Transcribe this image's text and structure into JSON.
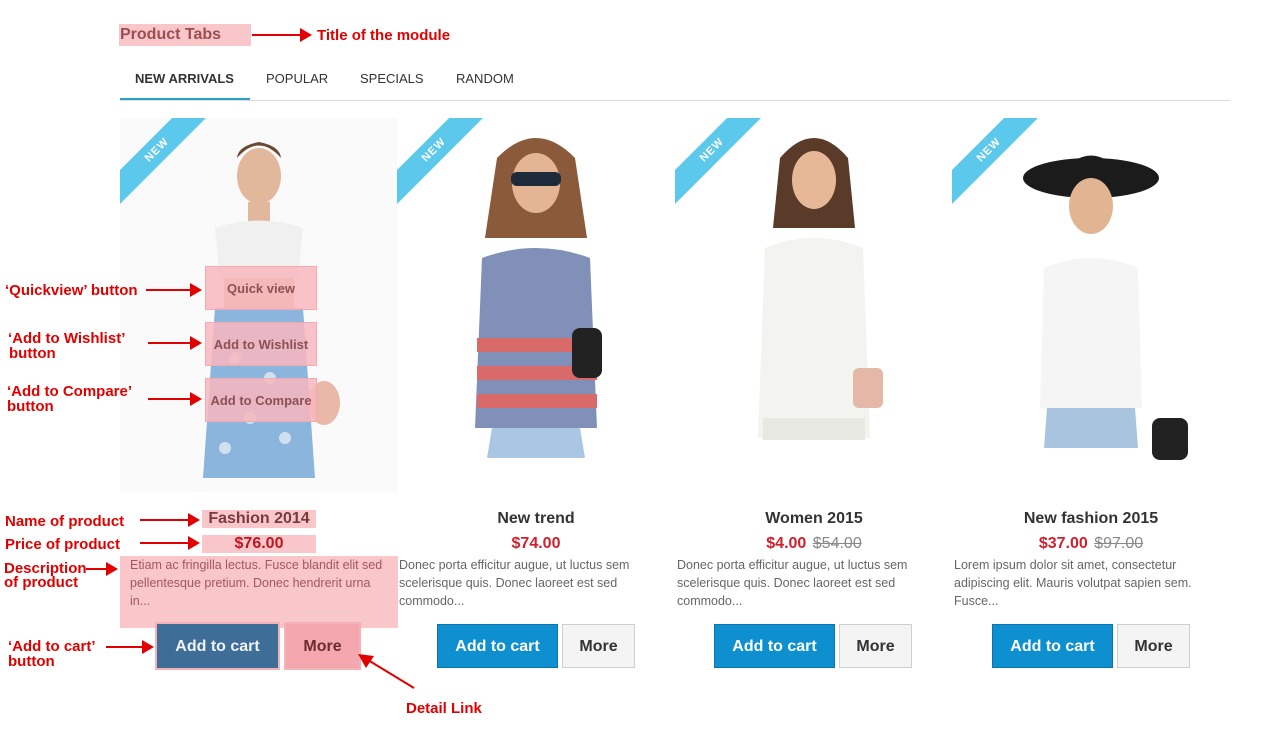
{
  "module": {
    "title": "Product Tabs"
  },
  "tabs": [
    "NEW ARRIVALS",
    "POPULAR",
    "SPECIALS",
    "RANDOM"
  ],
  "badge": "NEW",
  "products": [
    {
      "name": "Fashion 2014",
      "price": "$76.00",
      "old_price": "",
      "desc": "Etiam ac fringilla lectus. Fusce blandit elit sed pellentesque pretium. Donec hendrerit urna in...",
      "cart": "Add to cart",
      "more": "More",
      "quick": "Quick view",
      "wishlist": "Add to Wishlist",
      "compare": "Add to Compare"
    },
    {
      "name": "New trend",
      "price": "$74.00",
      "old_price": "",
      "desc": "Donec porta efficitur augue, ut luctus sem scelerisque quis. Donec laoreet est sed commodo...",
      "cart": "Add to cart",
      "more": "More"
    },
    {
      "name": "Women 2015",
      "price": "$4.00",
      "old_price": "$54.00",
      "desc": "Donec porta efficitur augue, ut luctus sem scelerisque quis. Donec laoreet est sed commodo...",
      "cart": "Add to cart",
      "more": "More"
    },
    {
      "name": "New fashion 2015",
      "price": "$37.00",
      "old_price": "$97.00",
      "desc": "Lorem ipsum dolor sit amet, consectetur adipiscing elit. Mauris volutpat sapien sem. Fusce...",
      "cart": "Add to cart",
      "more": "More"
    }
  ],
  "annotations": {
    "title": "Title of the module",
    "quickview": "‘Quickview’ button",
    "wishlist_1": "‘Add to Wishlist’",
    "wishlist_2": "button",
    "compare_1": "‘Add to Compare’",
    "compare_2": "button",
    "name": "Name of product",
    "price": "Price of product",
    "desc_1": "Description",
    "desc_2": "of product",
    "cart_1": "‘Add to cart’",
    "cart_2": "button",
    "detail": "Detail Link"
  },
  "colors": {
    "accent": "#2aa1c8",
    "cart": "#0e8fd0",
    "price": "#d11f2c",
    "highlight": "#f9c6c9",
    "annotation": "#e00000",
    "ribbon": "#5cc8ec"
  }
}
